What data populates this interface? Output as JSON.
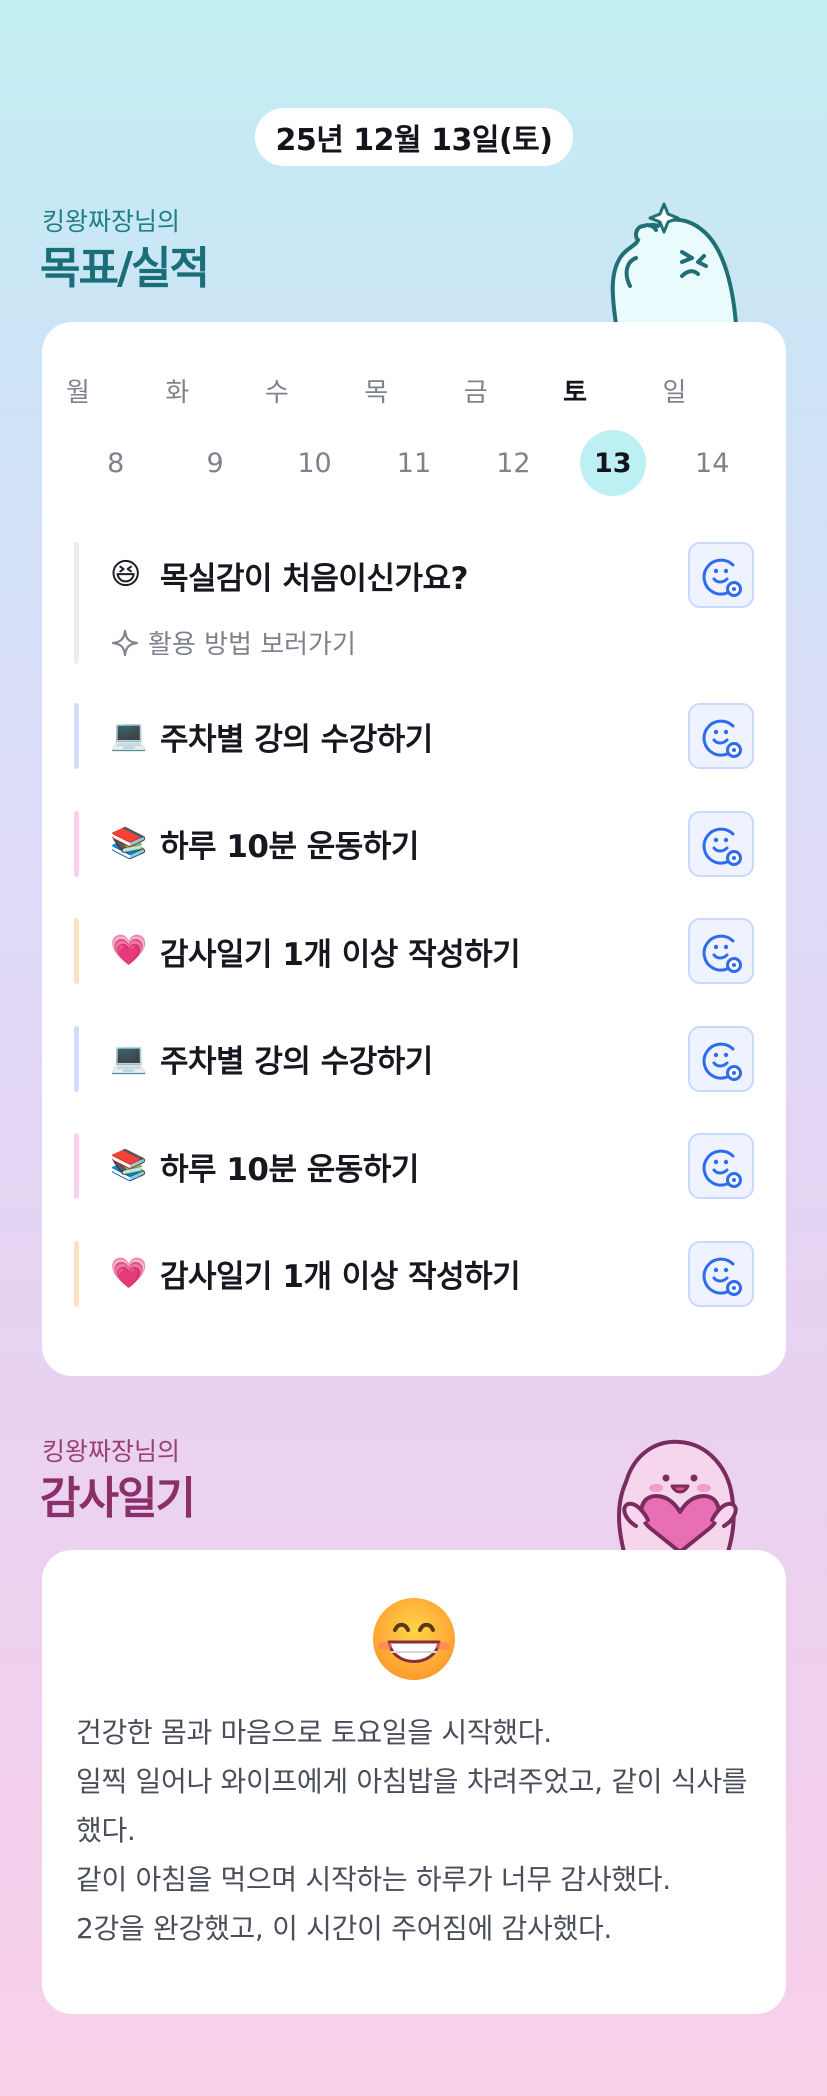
{
  "date_label": "25년 12월 13일(토)",
  "goal_section": {
    "subtitle": "킹왕짜장님의",
    "title": "목표/실적"
  },
  "week": {
    "days": [
      {
        "label": "월",
        "num": "8",
        "selected": false
      },
      {
        "label": "화",
        "num": "9",
        "selected": false
      },
      {
        "label": "수",
        "num": "10",
        "selected": false
      },
      {
        "label": "목",
        "num": "11",
        "selected": false
      },
      {
        "label": "금",
        "num": "12",
        "selected": false
      },
      {
        "label": "토",
        "num": "13",
        "selected": true
      },
      {
        "label": "일",
        "num": "14",
        "selected": false
      }
    ]
  },
  "intro": {
    "emoji": "😆",
    "title": "목실감이 처음이신가요?",
    "link": "활용 방법 보러가기"
  },
  "goals": [
    {
      "emoji": "💻",
      "text": "주차별 강의 수강하기",
      "bar_color": "#d2dcff"
    },
    {
      "emoji": "📚",
      "text": "하루 10분 운동하기",
      "bar_color": "#ffd0ea"
    },
    {
      "emoji": "💗",
      "text": "감사일기 1개 이상 작성하기",
      "bar_color": "#ffe1c2"
    },
    {
      "emoji": "💻",
      "text": "주차별 강의 수강하기",
      "bar_color": "#d2dcff"
    },
    {
      "emoji": "📚",
      "text": "하루 10분 운동하기",
      "bar_color": "#ffd0ea"
    },
    {
      "emoji": "💗",
      "text": "감사일기 1개 이상 작성하기",
      "bar_color": "#ffe1c2"
    }
  ],
  "gratitude_section": {
    "subtitle": "킹왕짜장님의",
    "title": "감사일기"
  },
  "gratitude": {
    "emoji": "😁",
    "lines": [
      "건강한 몸과 마음으로 토요일을 시작했다.",
      "일찍 일어나 와이프에게 아침밥을 차려주었고, 같이 식사를 했다.",
      "같이 아침을 먹으며 시작하는 하루가 너무 감사했다.",
      "2강을 완강했고, 이 시간이 주어짐에 감사했다."
    ]
  },
  "colors": {
    "goal_title": "#1a6e78",
    "gratitude_title": "#8a2f6a",
    "selected_day": "#bdf0f2",
    "react_button_bg": "#eef3ff",
    "react_icon": "#2d6cf0"
  }
}
